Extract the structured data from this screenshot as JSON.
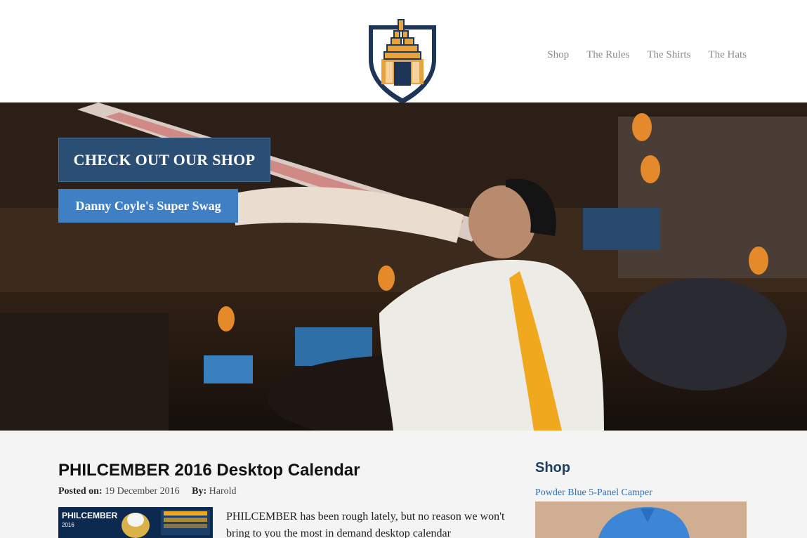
{
  "nav": {
    "items": [
      "Shop",
      "The Rules",
      "The Shirts",
      "The Hats"
    ]
  },
  "hero": {
    "cta_primary": "CHECK OUT OUR SHOP",
    "cta_secondary": "Danny Coyle's Super Swag"
  },
  "post": {
    "title": "PHILCEMBER 2016 Desktop Calendar",
    "posted_label": "Posted on:",
    "posted_date": "19 December 2016",
    "by_label": "By:",
    "author": "Harold",
    "excerpt": "PHILCEMBER has been rough lately, but no reason we won't bring to you the most in demand desktop calendar",
    "thumb_title": "PHILCEMBER",
    "thumb_year": "2016"
  },
  "sidebar": {
    "title": "Shop",
    "link": "Powder Blue 5-Panel Camper"
  },
  "colors": {
    "nav_text": "#8a8a8a",
    "cta_primary_bg": "#2a4e74",
    "cta_secondary_bg": "#3f7fc4",
    "sidebar_title": "#1d3f66",
    "link": "#2f6fb3",
    "logo_gold": "#e8a33a",
    "logo_navy": "#1d3557"
  }
}
